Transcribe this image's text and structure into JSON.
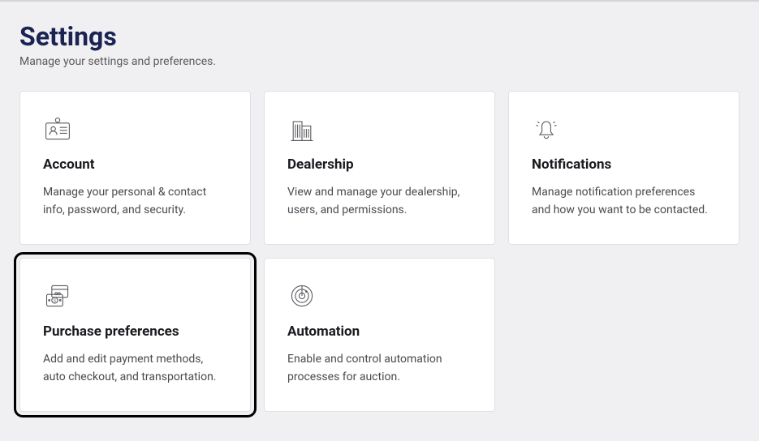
{
  "header": {
    "title": "Settings",
    "subtitle": "Manage your settings and preferences."
  },
  "cards": [
    {
      "title": "Account",
      "description": "Manage your personal & contact info, password, and security."
    },
    {
      "title": "Dealership",
      "description": "View and manage your dealership, users, and permissions."
    },
    {
      "title": "Notifications",
      "description": "Manage notification preferences and how you want to be contacted."
    },
    {
      "title": "Purchase preferences",
      "description": "Add and edit payment methods, auto checkout, and transportation."
    },
    {
      "title": "Automation",
      "description": "Enable and control automation processes for auction."
    }
  ]
}
